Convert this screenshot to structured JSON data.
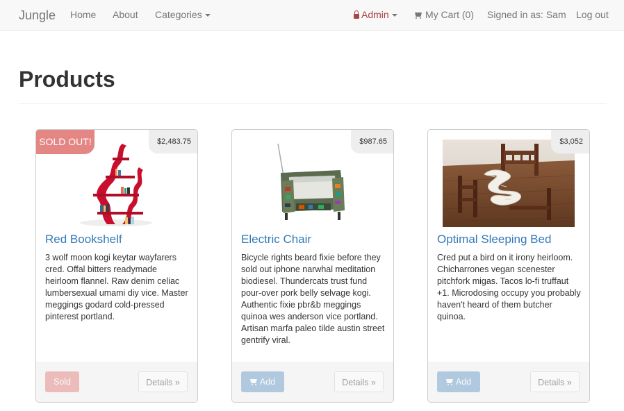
{
  "navbar": {
    "brand": "Jungle",
    "links": {
      "home": "Home",
      "about": "About",
      "categories": "Categories",
      "admin": "Admin",
      "cart": "My Cart (0)",
      "signed_in": "Signed in as: Sam",
      "logout": "Log out"
    }
  },
  "page": {
    "title": "Products"
  },
  "products": [
    {
      "name": "Red Bookshelf",
      "price": "$2,483.75",
      "badge": "SOLD OUT!",
      "description": "3 wolf moon kogi keytar wayfarers cred. Offal bitters readymade heirloom flannel. Raw denim celiac lumbersexual umami diy vice. Master meggings godard cold-pressed pinterest portland.",
      "action_label": "Sold",
      "details_label": "Details »"
    },
    {
      "name": "Electric Chair",
      "price": "$987.65",
      "description": "Bicycle rights beard fixie before they sold out iphone narwhal meditation biodiesel. Thundercats trust fund pour-over pork belly selvage kogi. Authentic fixie pbr&b meggings quinoa wes anderson vice portland. Artisan marfa paleo tilde austin street gentrify viral.",
      "action_label": "Add",
      "details_label": "Details »"
    },
    {
      "name": "Optimal Sleeping Bed",
      "price": "$3,052",
      "description": "Cred put a bird on it irony heirloom. Chicharrones vegan scenester pitchfork migas. Tacos lo-fi truffaut +1. Microdosing occupy you probably haven't heard of them butcher quinoa.",
      "action_label": "Add",
      "details_label": "Details »"
    }
  ],
  "colors": {
    "link": "#337ab7",
    "danger": "#d9534f",
    "admin": "#a94442"
  }
}
